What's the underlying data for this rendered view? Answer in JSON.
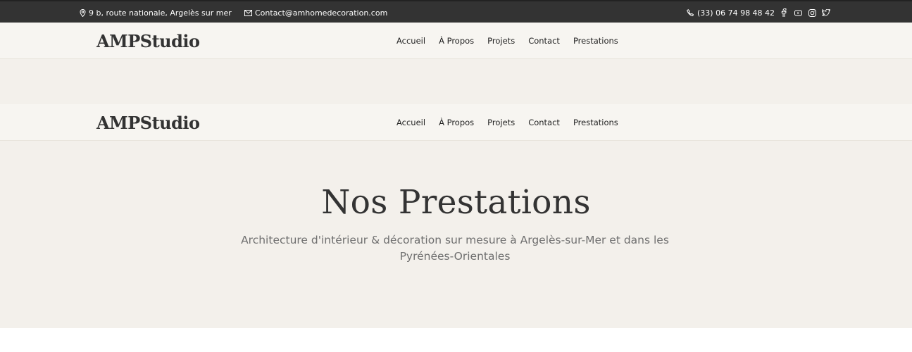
{
  "topbar": {
    "address": "9 b, route nationale, Argelès sur mer",
    "email": "Contact@amhomedecoration.com",
    "phone": "(33) 06 74 98 48 42",
    "social": [
      "facebook-icon",
      "youtube-icon",
      "instagram-icon",
      "twitter-icon"
    ],
    "background": "#333333"
  },
  "header": {
    "logo": "AMPStudio",
    "nav": [
      "Accueil",
      "À Propos",
      "Projets",
      "Contact",
      "Prestations"
    ],
    "background": "#f7f5f1"
  },
  "hero": {
    "title": "Nos Prestations",
    "subtitle": "Architecture d'intérieur & décoration sur mesure à Argelès-sur-Mer et dans les Pyrénées-Orientales",
    "background": "#f3f0eb"
  }
}
